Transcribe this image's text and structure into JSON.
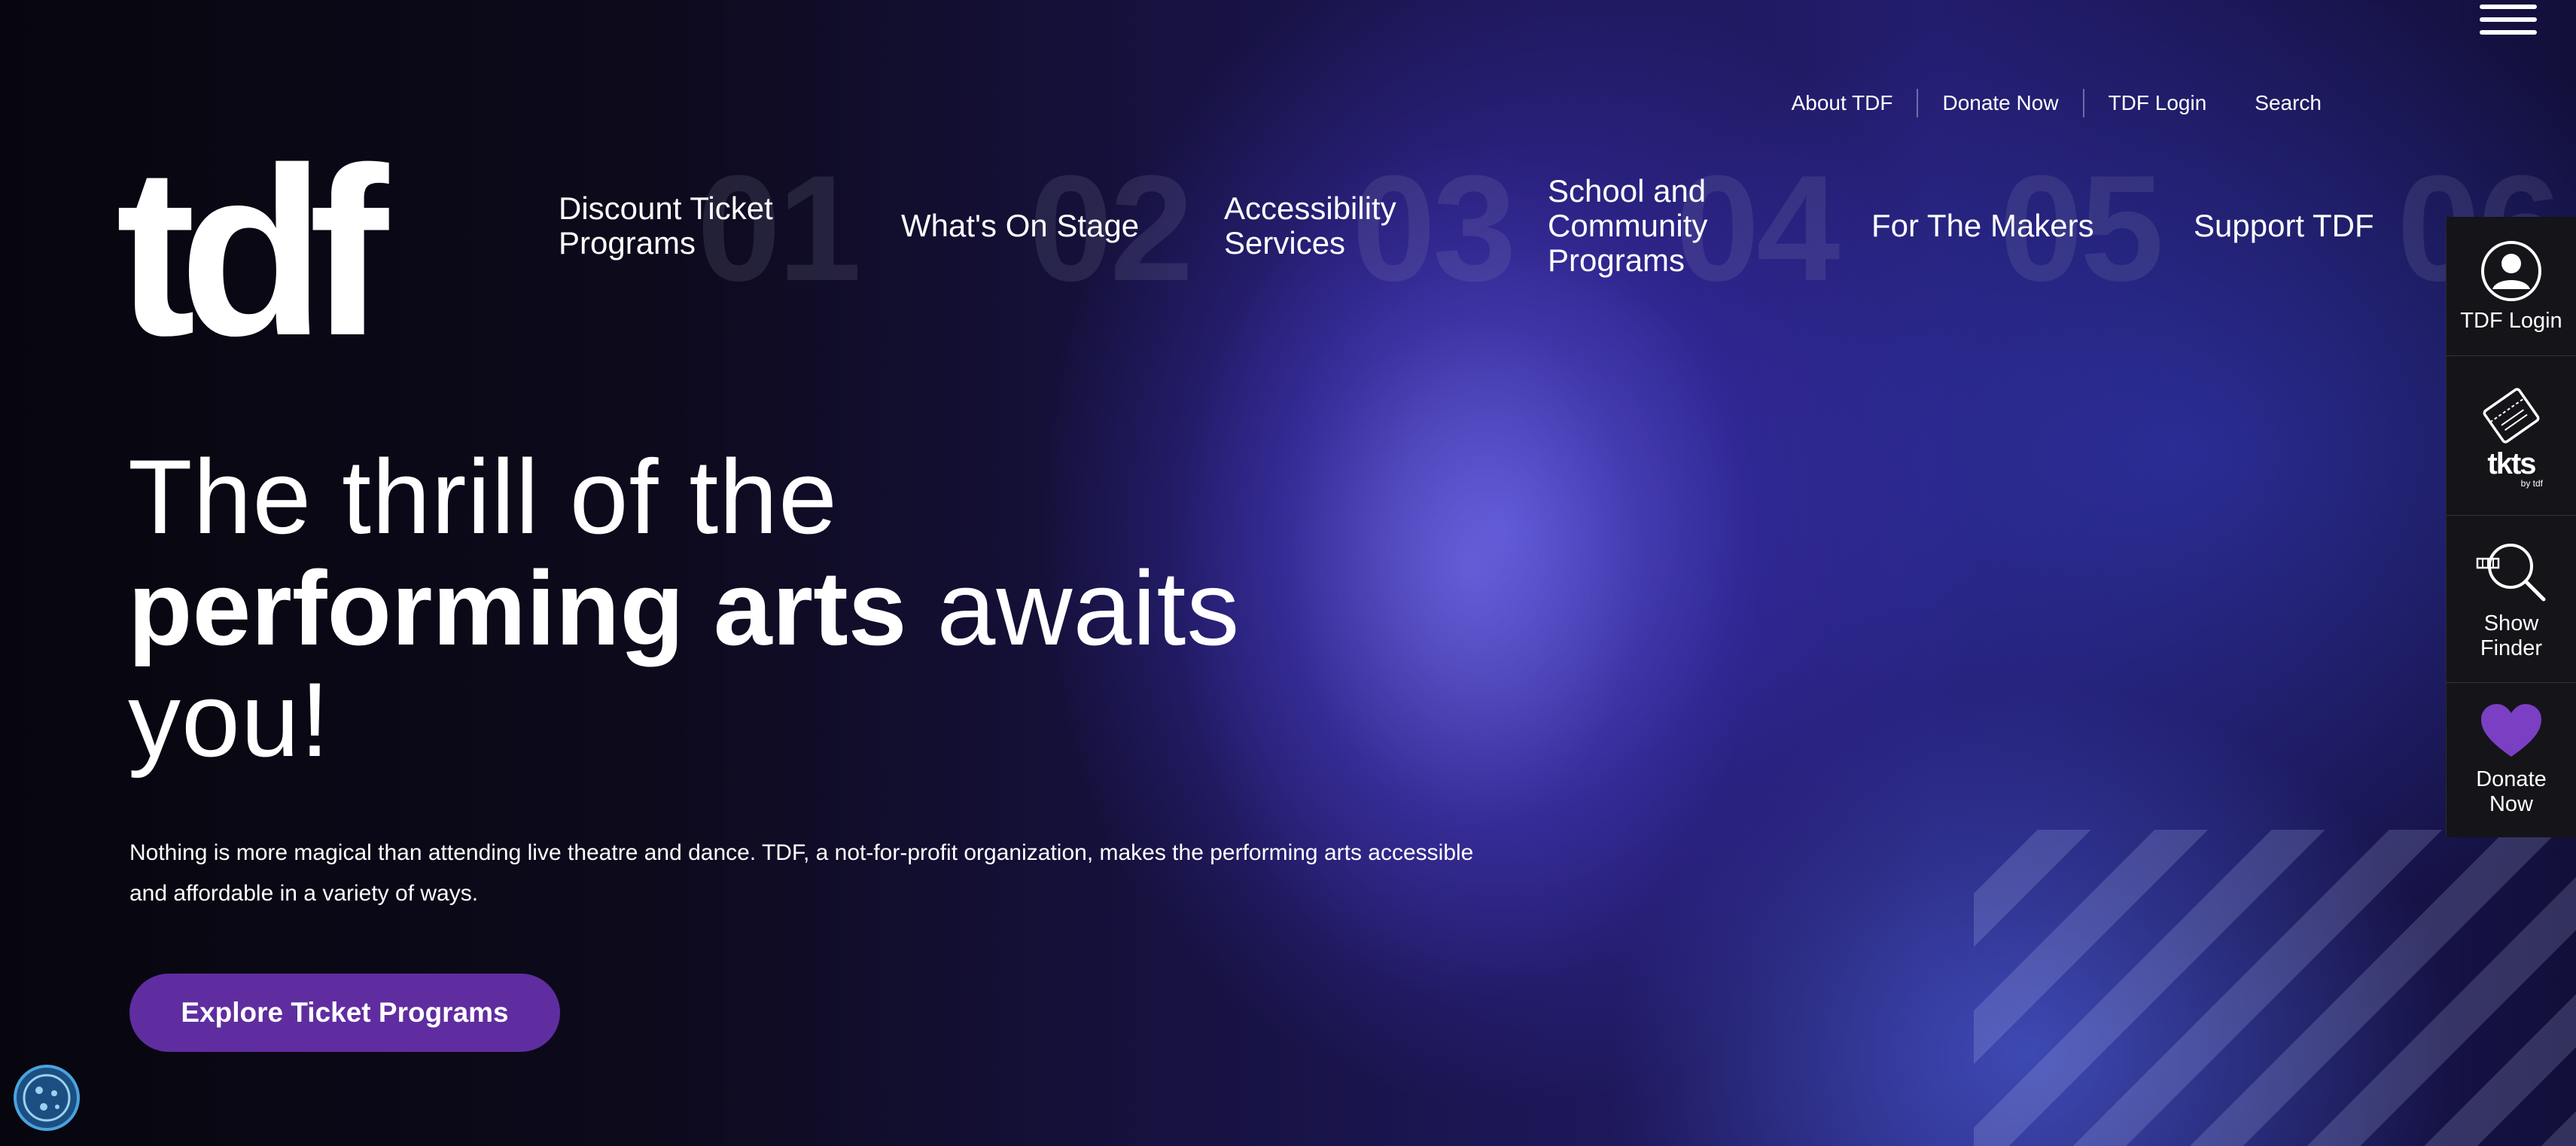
{
  "brand": {
    "logo_text": "tdf",
    "accent_color": "#5f2da0"
  },
  "utility_nav": [
    "About TDF",
    "Donate Now",
    "TDF Login",
    "Search"
  ],
  "main_nav": [
    {
      "num": "01",
      "label": "Discount Ticket\nPrograms"
    },
    {
      "num": "02",
      "label": "What's On Stage"
    },
    {
      "num": "03",
      "label": "Accessibility\nServices"
    },
    {
      "num": "04",
      "label": "School and\nCommunity\nPrograms"
    },
    {
      "num": "05",
      "label": "For The Makers"
    },
    {
      "num": "06",
      "label": "Support TDF"
    }
  ],
  "sidebar": [
    {
      "label": "TDF Login",
      "icon": "user-icon"
    },
    {
      "label": "",
      "icon": "tkts-ticket-icon",
      "logo_text": "tkts",
      "logo_sub": "by tdf"
    },
    {
      "label": "Show\nFinder",
      "icon": "show-finder-search-icon"
    },
    {
      "label": "Donate\nNow",
      "icon": "heart-icon"
    }
  ],
  "hero": {
    "headline_line1": "The thrill of the",
    "headline_bold": "performing arts",
    "headline_rest": " awaits",
    "headline_line3": "you!",
    "subtext": "Nothing is more magical than attending live theatre and dance. TDF, a not-for-profit organization, makes the performing arts accessible and affordable in a variety of ways.",
    "cta_label": "Explore Ticket Programs"
  },
  "cookie_button": {
    "icon": "cookie-icon"
  },
  "menu": {
    "icon": "hamburger-icon"
  }
}
